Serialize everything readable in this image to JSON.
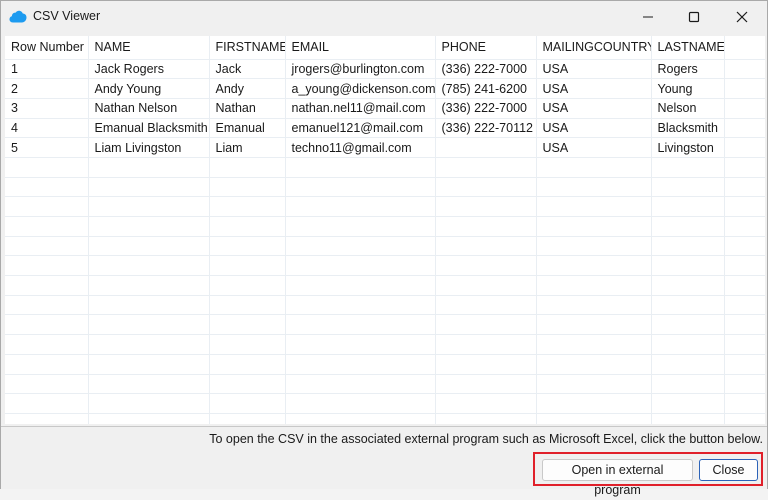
{
  "window": {
    "title": "CSV Viewer",
    "accent_color": "#1d9bf0"
  },
  "table": {
    "headers": [
      "Row Number",
      "NAME",
      "FIRSTNAME",
      "EMAIL",
      "PHONE",
      "MAILINGCOUNTRY",
      "LASTNAME",
      ""
    ],
    "rows": [
      [
        "1",
        "Jack Rogers",
        "Jack",
        "jrogers@burlington.com",
        "(336) 222-7000",
        "USA",
        "Rogers",
        ""
      ],
      [
        "2",
        "Andy Young",
        "Andy",
        "a_young@dickenson.com",
        "(785) 241-6200",
        "USA",
        "Young",
        ""
      ],
      [
        "3",
        "Nathan Nelson",
        "Nathan",
        "nathan.nel11@mail.com",
        "(336) 222-7000",
        "USA",
        "Nelson",
        ""
      ],
      [
        "4",
        "Emanual Blacksmith",
        "Emanual",
        "emanuel121@mail.com",
        "(336) 222-70112",
        "USA",
        "Blacksmith",
        ""
      ],
      [
        "5",
        "Liam Livingston",
        "Liam",
        "techno11@gmail.com",
        "",
        "USA",
        "Livingston",
        ""
      ]
    ]
  },
  "footer": {
    "info": "To open the CSV in the associated external program such as Microsoft Excel, click the button below.",
    "open_external_label": "Open in external program",
    "close_label": "Close",
    "highlight_color": "#e0202a"
  }
}
